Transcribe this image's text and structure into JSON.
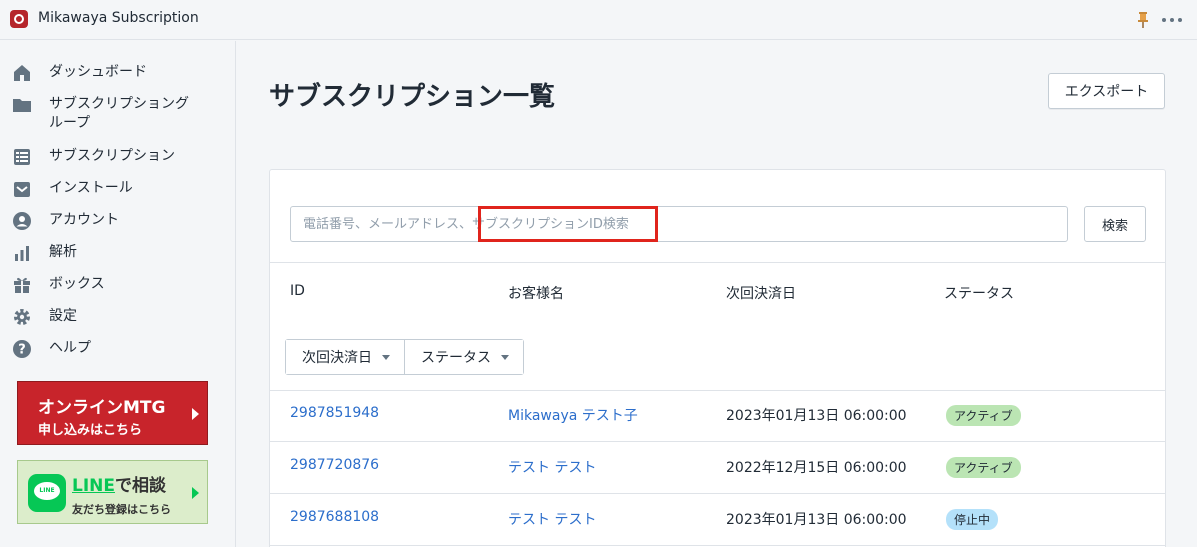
{
  "app": {
    "title": "Mikawaya Subscription",
    "logo_icon": "shopping-bag-icon"
  },
  "sidebar": {
    "items": [
      {
        "label": "ダッシュボード",
        "icon": "home-icon"
      },
      {
        "label": "サブスクリプショングループ",
        "icon": "folder-icon"
      },
      {
        "label": "サブスクリプション",
        "icon": "list-icon"
      },
      {
        "label": "インストール",
        "icon": "inbox-icon"
      },
      {
        "label": "アカウント",
        "icon": "user-icon"
      },
      {
        "label": "解析",
        "icon": "analytics-icon"
      },
      {
        "label": "ボックス",
        "icon": "gift-icon"
      },
      {
        "label": "設定",
        "icon": "gear-icon"
      },
      {
        "label": "ヘルプ",
        "icon": "help-icon"
      }
    ],
    "promo_mtg": {
      "line1": "オンラインMTG",
      "line2": "申し込みはこちら"
    },
    "promo_line": {
      "badge": "LINE",
      "line_word": "LINE",
      "line1_rest": "で相談",
      "line2": "友だち登録はこちら"
    }
  },
  "main": {
    "title": "サブスクリプション一覧",
    "export_label": "エクスポート",
    "search": {
      "placeholder": "電話番号、メールアドレス、サブスクリプションID検索",
      "button_label": "検索"
    },
    "columns": [
      "ID",
      "お客様名",
      "次回決済日",
      "ステータス"
    ],
    "filters": [
      "次回決済日",
      "ステータス"
    ],
    "rows": [
      {
        "id": "2987851948",
        "customer": "Mikawaya テスト子",
        "next_payment": "2023年01月13日 06:00:00",
        "status": "アクティブ"
      },
      {
        "id": "2987720876",
        "customer": "テスト テスト",
        "next_payment": "2022年12月15日 06:00:00",
        "status": "アクティブ"
      },
      {
        "id": "2987688108",
        "customer": "テスト テスト",
        "next_payment": "2023年01月13日 06:00:00",
        "status": "停止中"
      }
    ]
  },
  "colors": {
    "accent_link": "#2c6ecb",
    "highlight_box": "#e0241c",
    "badge_active": "#bbe5b3",
    "badge_stopped": "#b4e1fa",
    "promo_red": "#c8242b",
    "line_green": "#06c755"
  }
}
